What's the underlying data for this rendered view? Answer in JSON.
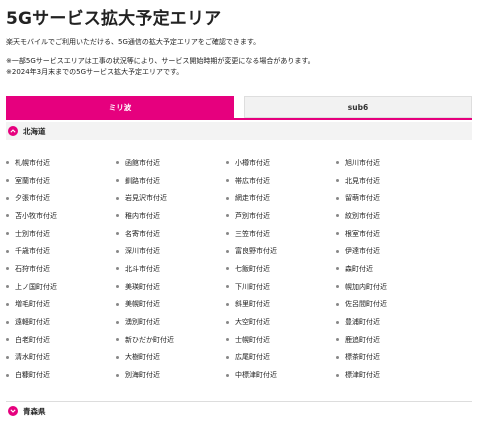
{
  "page_title": "5Gサービス拡大予定エリア",
  "intro": "楽天モバイルでご利用いただける、5G通信の拡大予定エリアをご確認できます。",
  "notes": [
    "※一部5Gサービスエリアは工事の状況等により、サービス開始時期が変更になる場合があります。",
    "※2024年3月末までの5Gサービス拡大予定エリアです。"
  ],
  "tabs": [
    {
      "label": "ミリ波",
      "active": true
    },
    {
      "label": "sub6",
      "active": false
    }
  ],
  "colors": {
    "accent": "#e6007e",
    "inactive_tab": "#f2f2f2"
  },
  "regions": [
    {
      "name": "北海道",
      "expanded": true,
      "icon": "chevron-up-icon",
      "cities": [
        "札幌市付近",
        "函館市付近",
        "小樽市付近",
        "旭川市付近",
        "室蘭市付近",
        "釧路市付近",
        "帯広市付近",
        "北見市付近",
        "夕張市付近",
        "岩見沢市付近",
        "網走市付近",
        "留萌市付近",
        "苫小牧市付近",
        "稚内市付近",
        "芦別市付近",
        "紋別市付近",
        "士別市付近",
        "名寄市付近",
        "三笠市付近",
        "根室市付近",
        "千歳市付近",
        "深川市付近",
        "富良野市付近",
        "伊達市付近",
        "石狩市付近",
        "北斗市付近",
        "七飯町付近",
        "森町付近",
        "上ノ国町付近",
        "美瑛町付近",
        "下川町付近",
        "幌加内町付近",
        "増毛町付近",
        "美幌町付近",
        "斜里町付近",
        "佐呂間町付近",
        "遠軽町付近",
        "湧別町付近",
        "大空町付近",
        "豊浦町付近",
        "白老町付近",
        "新ひだか町付近",
        "士幌町付近",
        "鹿追町付近",
        "清水町付近",
        "大樹町付近",
        "広尾町付近",
        "標茶町付近",
        "白糠町付近",
        "別海町付近",
        "中標津町付近",
        "標津町付近"
      ]
    },
    {
      "name": "青森県",
      "expanded": false,
      "icon": "chevron-down-icon"
    }
  ]
}
